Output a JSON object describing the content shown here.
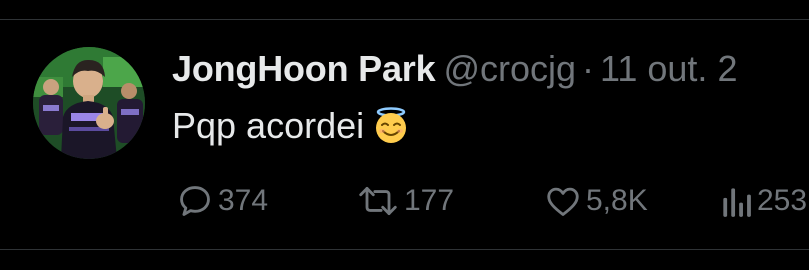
{
  "author": {
    "display_name": "JongHoon Park",
    "handle": "@crocjg",
    "separator": "·",
    "date": "11 out. 2"
  },
  "tweet": {
    "text": "Pqp acordei",
    "emoji": "smiling-face-with-halo"
  },
  "actions": {
    "replies": "374",
    "retweets": "177",
    "likes": "5,8K",
    "views": "253"
  },
  "colors": {
    "background": "#000000",
    "primary_text": "#e7e9ea",
    "secondary_text": "#71767b",
    "divider": "#2f3336"
  },
  "icons": [
    "reply-icon",
    "retweet-icon",
    "like-icon",
    "views-icon"
  ]
}
